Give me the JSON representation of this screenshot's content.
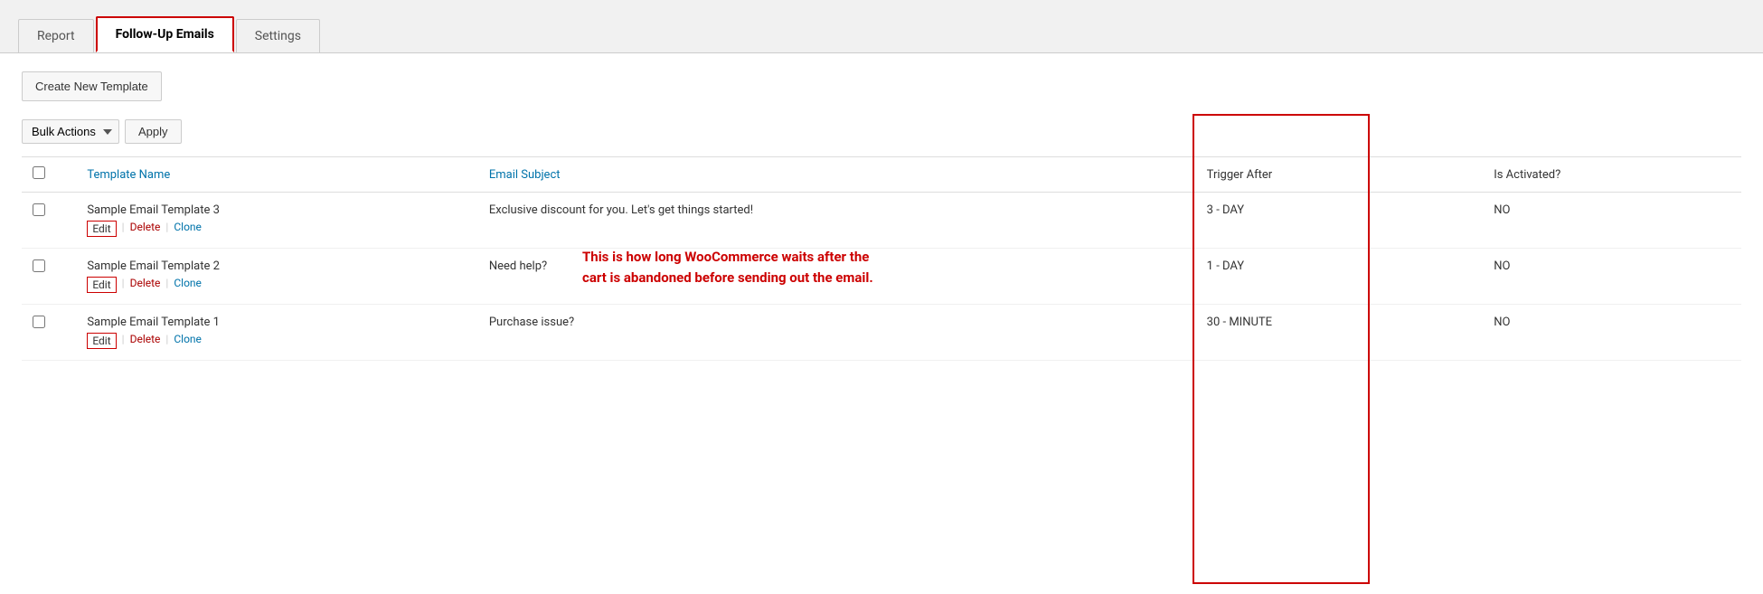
{
  "tabs": [
    {
      "id": "report",
      "label": "Report",
      "active": false
    },
    {
      "id": "follow-up-emails",
      "label": "Follow-Up Emails",
      "active": true
    },
    {
      "id": "settings",
      "label": "Settings",
      "active": false
    }
  ],
  "toolbar": {
    "create_button_label": "Create New Template"
  },
  "bulk_actions": {
    "dropdown_label": "Bulk Actions",
    "apply_label": "Apply"
  },
  "table": {
    "columns": [
      {
        "id": "checkbox",
        "label": ""
      },
      {
        "id": "template-name",
        "label": "Template Name"
      },
      {
        "id": "email-subject",
        "label": "Email Subject"
      },
      {
        "id": "trigger-after",
        "label": "Trigger After"
      },
      {
        "id": "is-activated",
        "label": "Is Activated?"
      }
    ],
    "rows": [
      {
        "id": 3,
        "template_name": "Sample Email Template 3",
        "email_subject": "Exclusive discount for you. Let's get things started!",
        "trigger_after": "3 - DAY",
        "is_activated": "NO",
        "actions": [
          "Edit",
          "Delete",
          "Clone"
        ]
      },
      {
        "id": 2,
        "template_name": "Sample Email Template 2",
        "email_subject": "Need help?",
        "trigger_after": "1 - DAY",
        "is_activated": "NO",
        "actions": [
          "Edit",
          "Delete",
          "Clone"
        ]
      },
      {
        "id": 1,
        "template_name": "Sample Email Template 1",
        "email_subject": "Purchase issue?",
        "trigger_after": "30 - MINUTE",
        "is_activated": "NO",
        "actions": [
          "Edit",
          "Delete",
          "Clone"
        ]
      }
    ]
  },
  "annotation": {
    "text": "This is how long WooCommerce waits after the cart is abandoned before sending out the email."
  }
}
